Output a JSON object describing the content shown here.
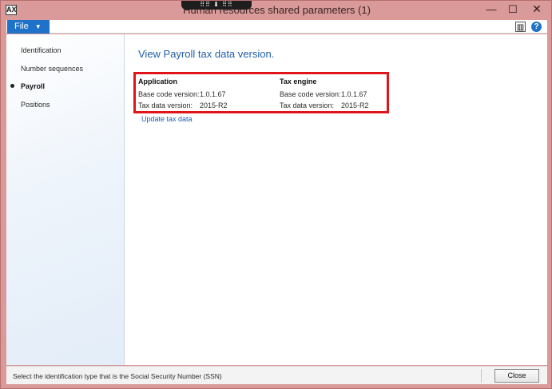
{
  "window": {
    "title": "Human resources shared parameters (1)",
    "app_icon_glyph": "AX",
    "grabber_glyph": "⠿⠿ ⬇ ⠿⠿",
    "min_glyph": "—",
    "max_glyph": "☐",
    "close_glyph": "✕"
  },
  "ribbon": {
    "file_label": "File",
    "file_caret": "▼",
    "layout_icon": "▥",
    "help_icon": "?"
  },
  "sidebar": {
    "items": [
      {
        "label": "Identification"
      },
      {
        "label": "Number sequences"
      },
      {
        "label": "Payroll",
        "active": true
      },
      {
        "label": "Positions"
      }
    ]
  },
  "main": {
    "heading": "View Payroll tax data version.",
    "application": {
      "header": "Application",
      "base_code_label": "Base code version:",
      "base_code_value": "1.0.1.67",
      "tax_data_label": "Tax data version:",
      "tax_data_value": "2015-R2"
    },
    "tax_engine": {
      "header": "Tax engine",
      "base_code_label": "Base code version:",
      "base_code_value": "1.0.1.67",
      "tax_data_label": "Tax data version:",
      "tax_data_value": "2015-R2"
    },
    "update_link": "Update tax data"
  },
  "status": {
    "text": "Select the identification type that is the Social Security Number (SSN)",
    "close_label": "Close"
  },
  "colors": {
    "accent": "#1e72c9",
    "heading": "#1f5ea8",
    "highlight_border": "#e0141b",
    "window_frame": "#d99a99"
  }
}
